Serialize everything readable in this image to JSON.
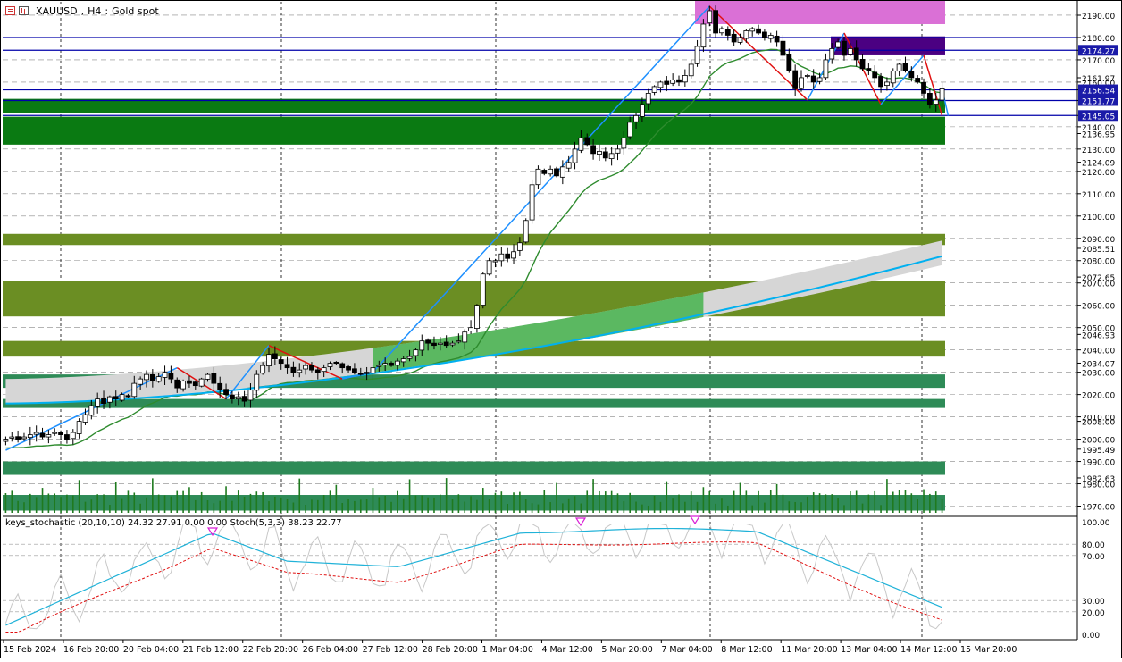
{
  "window": {
    "symbol": "XAUUSD",
    "timeframe": "H4",
    "description": "Gold spot"
  },
  "indicator": {
    "name": "keys_stochastic (20,10,10)",
    "values": "24.32 27.91 0.00 0.00",
    "name2": "Stoch(5,3,3)",
    "values2": "38.23 22.77"
  },
  "price_axis_labels": [
    "2190.00",
    "2180.00",
    "2174.27",
    "2170.00",
    "2161.97",
    "2160.00",
    "2156.54",
    "2151.77",
    "2145.05",
    "2140.00",
    "2136.95",
    "2130.00",
    "2124.09",
    "2120.00",
    "2110.00",
    "2100.00",
    "2090.00",
    "2085.51",
    "2080.00",
    "2072.65",
    "2070.00",
    "2060.00",
    "2050.00",
    "2046.93",
    "2040.00",
    "2034.07",
    "2030.00",
    "2020.00",
    "2010.00",
    "2008.00",
    "2000.00",
    "1995.49",
    "1990.00",
    "1982.63",
    "1980.00",
    "1970.00"
  ],
  "highlight_labels": [
    {
      "value": "2174.27",
      "bg": "#1a1aa8",
      "fg": "#ffffff"
    },
    {
      "value": "2156.54",
      "bg": "#1a1aa8",
      "fg": "#ffffff"
    },
    {
      "value": "2151.77",
      "bg": "#1a1aa8",
      "fg": "#ffffff"
    },
    {
      "value": "2145.05",
      "bg": "#1a1aa8",
      "fg": "#ffffff"
    }
  ],
  "stoch_axis_labels": [
    "100.00",
    "80.00",
    "70.00",
    "30.00",
    "20.00",
    "0.00"
  ],
  "time_labels": [
    "15 Feb 2024",
    "16 Feb 20:00",
    "20 Feb 04:00",
    "21 Feb 12:00",
    "22 Feb 20:00",
    "26 Feb 04:00",
    "27 Feb 12:00",
    "28 Feb 20:00",
    "1 Mar 04:00",
    "4 Mar 12:00",
    "5 Mar 20:00",
    "7 Mar 04:00",
    "8 Mar 12:00",
    "11 Mar 20:00",
    "13 Mar 04:00",
    "14 Mar 12:00",
    "15 Mar 20:00"
  ],
  "colors": {
    "bull": "#ffffff",
    "bear": "#000000",
    "ma_fast": "#2e8b2e",
    "ma_slow": "#00b0f0",
    "zigzag_up": "#1e90ff",
    "zigzag_down": "#e01010",
    "zone_green": "#0a7a12",
    "zone_olive": "#6b8e23",
    "zone_teal": "#2e8b57",
    "zone_pink": "#da70d6",
    "zone_purple": "#4b0082",
    "level_line": "#0000aa"
  },
  "chart_data": {
    "type": "candlestick",
    "symbol": "XAUUSD",
    "timeframe": "H4",
    "y_range": [
      1967,
      2196
    ],
    "stoch_range": [
      0,
      100
    ],
    "price_levels": [
      2180.0,
      2174.27,
      2156.54,
      2151.77,
      2145.05
    ],
    "zones": [
      {
        "from": 2186.0,
        "to": 2198.0,
        "color": "pink"
      },
      {
        "from": 2172.0,
        "to": 2180.5,
        "color": "purple"
      },
      {
        "from": 2146.0,
        "to": 2152.5,
        "color": "green"
      },
      {
        "from": 2132.0,
        "to": 2144.5,
        "color": "green"
      },
      {
        "from": 2087.0,
        "to": 2092.0,
        "color": "olive"
      },
      {
        "from": 2055.0,
        "to": 2071.0,
        "color": "olive"
      },
      {
        "from": 2037.0,
        "to": 2044.0,
        "color": "olive"
      },
      {
        "from": 2023.0,
        "to": 2029.0,
        "color": "teal"
      },
      {
        "from": 2014.0,
        "to": 2018.0,
        "color": "teal"
      },
      {
        "from": 1984.0,
        "to": 1990.0,
        "color": "teal"
      },
      {
        "from": 1968.0,
        "to": 1975.0,
        "color": "teal"
      }
    ],
    "closes": [
      2000,
      2001,
      2000,
      2001,
      2002,
      2003,
      2001,
      2002,
      2003,
      2002,
      2000,
      2003,
      2008,
      2011,
      2015,
      2018,
      2016,
      2019,
      2018,
      2020,
      2019,
      2025,
      2027,
      2029,
      2026,
      2028,
      2030,
      2027,
      2023,
      2026,
      2025,
      2024,
      2027,
      2029,
      2025,
      2022,
      2020,
      2018,
      2019,
      2017,
      2022,
      2029,
      2033,
      2038,
      2036,
      2034,
      2032,
      2030,
      2031,
      2033,
      2031,
      2030,
      2032,
      2034,
      2034,
      2032,
      2031,
      2030,
      2029,
      2030,
      2032,
      2033,
      2034,
      2033,
      2035,
      2036,
      2037,
      2040,
      2044,
      2043,
      2042,
      2043,
      2042,
      2043,
      2044,
      2048,
      2050,
      2060,
      2074,
      2080,
      2080,
      2083,
      2081,
      2084,
      2088,
      2098,
      2114,
      2121,
      2119,
      2121,
      2118,
      2122,
      2124,
      2130,
      2135,
      2132,
      2128,
      2129,
      2126,
      2128,
      2130,
      2135,
      2142,
      2145,
      2150,
      2155,
      2158,
      2160,
      2159,
      2161,
      2160,
      2163,
      2168,
      2176,
      2186,
      2192,
      2182,
      2184,
      2181,
      2178,
      2180,
      2183,
      2184,
      2182,
      2180,
      2181,
      2178,
      2172,
      2165,
      2157,
      2162,
      2163,
      2160,
      2162,
      2170,
      2175,
      2178,
      2172,
      2175,
      2170,
      2166,
      2165,
      2162,
      2158,
      2160,
      2165,
      2168,
      2165,
      2162,
      2160,
      2155,
      2150,
      2152,
      2157
    ]
  }
}
